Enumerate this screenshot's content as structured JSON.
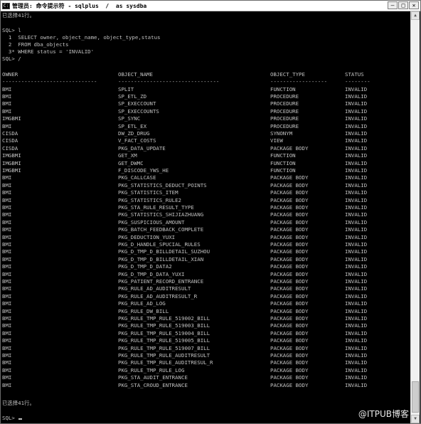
{
  "window": {
    "title": "管理员: 命令提示符 - sqlplus  /  as sysdba",
    "icon": "cmd-icon",
    "minimize": "–",
    "maximize": "□",
    "close": "✕"
  },
  "console": {
    "top_message": "已选择41行。",
    "query_lines": [
      "SQL> l",
      "  1  SELECT owner, object_name, object_type,status",
      "  2  FROM dba_objects",
      "  3* WHERE status = 'INVALID'",
      "SQL> /"
    ],
    "headers": [
      "OWNER",
      "OBJECT_NAME",
      "OBJECT_TYPE",
      "STATUS"
    ],
    "separators": [
      "------------------------------",
      "--------------------------------",
      "------------------",
      "--------"
    ],
    "rows": [
      [
        "BMI",
        "SPLIT",
        "FUNCTION",
        "INVALID"
      ],
      [
        "BMI",
        "SP_ETL_ZD",
        "PROCEDURE",
        "INVALID"
      ],
      [
        "BMI",
        "SP_EXECCOUNT",
        "PROCEDURE",
        "INVALID"
      ],
      [
        "BMI",
        "SP_EXECCOUNTS",
        "PROCEDURE",
        "INVALID"
      ],
      [
        "IMGBMI",
        "SP_SYNC",
        "PROCEDURE",
        "INVALID"
      ],
      [
        "BMI",
        "SP_ETL_EX",
        "PROCEDURE",
        "INVALID"
      ],
      [
        "CISDA",
        "DW_ZD_DRUG",
        "SYNONYM",
        "INVALID"
      ],
      [
        "CISDA",
        "V_FACT_COSTS",
        "VIEW",
        "INVALID"
      ],
      [
        "CISDA",
        "PKG_DATA_UPDATE",
        "PACKAGE BODY",
        "INVALID"
      ],
      [
        "IMGBMI",
        "GET_XM",
        "FUNCTION",
        "INVALID"
      ],
      [
        "IMGBMI",
        "GET_DWMC",
        "FUNCTION",
        "INVALID"
      ],
      [
        "IMGBMI",
        "F_DISCODE_YWS_HE",
        "FUNCTION",
        "INVALID"
      ],
      [
        "BMI",
        "PKG_CALLCASE",
        "PACKAGE BODY",
        "INVALID"
      ],
      [
        "BMI",
        "PKG_STATISTICS_DEDUCT_POINTS",
        "PACKAGE BODY",
        "INVALID"
      ],
      [
        "BMI",
        "PKG_STATISTICS_ITEM",
        "PACKAGE BODY",
        "INVALID"
      ],
      [
        "BMI",
        "PKG_STATISTICS_RULE2",
        "PACKAGE BODY",
        "INVALID"
      ],
      [
        "BMI",
        "PKG_STA_RULE_RESULT_TYPE",
        "PACKAGE BODY",
        "INVALID"
      ],
      [
        "BMI",
        "PKG_STATISTICS_SHIJIAZHUANG",
        "PACKAGE BODY",
        "INVALID"
      ],
      [
        "BMI",
        "PKG_SUSPICIOUS_AMOUNT",
        "PACKAGE BODY",
        "INVALID"
      ],
      [
        "BMI",
        "PKG_BATCH_FEEDBACK_COMPLETE",
        "PACKAGE BODY",
        "INVALID"
      ],
      [
        "BMI",
        "PKG_DEDUCTION_YUXI",
        "PACKAGE BODY",
        "INVALID"
      ],
      [
        "BMI",
        "PKG_D_HANDLE_SPUCIAL_RULES",
        "PACKAGE BODY",
        "INVALID"
      ],
      [
        "BMI",
        "PKG_D_TMP_D_BILLDETAIL_SUZHOU",
        "PACKAGE BODY",
        "INVALID"
      ],
      [
        "BMI",
        "PKG_D_TMP_D_BILLDETAIL_XIAN",
        "PACKAGE BODY",
        "INVALID"
      ],
      [
        "BMI",
        "PKG_D_TMP_D_DATA2",
        "PACKAGE BODY",
        "INVALID"
      ],
      [
        "BMI",
        "PKG_D_TMP_D_DATA_YUXI",
        "PACKAGE BODY",
        "INVALID"
      ],
      [
        "BMI",
        "PKG_PATIENT_RECORD_ENTRANCE",
        "PACKAGE BODY",
        "INVALID"
      ],
      [
        "BMI",
        "PKG_RULE_AD_AUDITRESULT",
        "PACKAGE BODY",
        "INVALID"
      ],
      [
        "BMI",
        "PKG_RULE_AD_AUDITRESULT_R",
        "PACKAGE BODY",
        "INVALID"
      ],
      [
        "BMI",
        "PKG_RULE_AD_LOG",
        "PACKAGE BODY",
        "INVALID"
      ],
      [
        "BMI",
        "PKG_RULE_DW_BILL",
        "PACKAGE BODY",
        "INVALID"
      ],
      [
        "BMI",
        "PKG_RULE_TMP_RULE_519002_BILL",
        "PACKAGE BODY",
        "INVALID"
      ],
      [
        "BMI",
        "PKG_RULE_TMP_RULE_519003_BILL",
        "PACKAGE BODY",
        "INVALID"
      ],
      [
        "BMI",
        "PKG_RULE_TMP_RULE_519004_BILL",
        "PACKAGE BODY",
        "INVALID"
      ],
      [
        "BMI",
        "PKG_RULE_TMP_RULE_519005_BILL",
        "PACKAGE BODY",
        "INVALID"
      ],
      [
        "BMI",
        "PKG_RULE_TMP_RULE_519007_BILL",
        "PACKAGE BODY",
        "INVALID"
      ],
      [
        "BMI",
        "PKG_RULE_TMP_RULE_AUDITRESULT",
        "PACKAGE BODY",
        "INVALID"
      ],
      [
        "BMI",
        "PKG_RULE_TMP_RULE_AUDITRESUL_R",
        "PACKAGE BODY",
        "INVALID"
      ],
      [
        "BMI",
        "PKG_RULE_TMP_RULE_LOG",
        "PACKAGE BODY",
        "INVALID"
      ],
      [
        "BMI",
        "PKG_STA_AUDIT_ENTRANCE",
        "PACKAGE BODY",
        "INVALID"
      ],
      [
        "BMI",
        "PKG_STA_CROUD_ENTRANCE",
        "PACKAGE BODY",
        "INVALID"
      ]
    ],
    "footer_message": "已选择41行。",
    "prompt": "SQL> "
  },
  "watermark": "@ITPUB博客"
}
